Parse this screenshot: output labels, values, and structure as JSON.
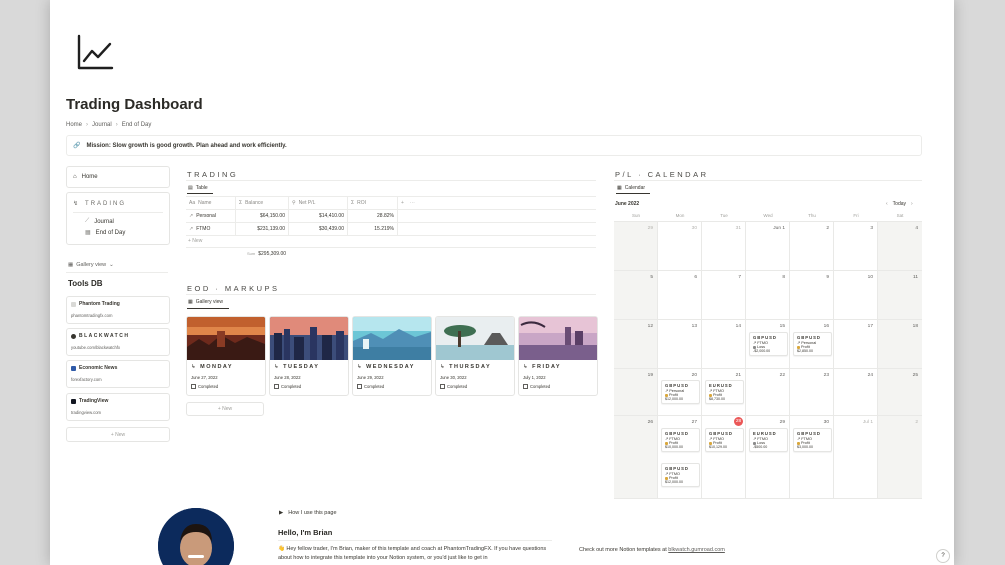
{
  "page": {
    "title": "Trading Dashboard",
    "breadcrumbs": [
      "Home",
      "Journal",
      "End of Day"
    ],
    "callout": "Mission: Slow growth is good growth. Plan ahead and work efficiently."
  },
  "nav": {
    "home": "Home",
    "trading_header": "TRADING",
    "items": [
      "Journal",
      "End of Day"
    ]
  },
  "tools": {
    "view_label": "Gallery view",
    "title": "Tools DB",
    "cards": [
      {
        "name": "Phantom Trading",
        "url": "phantomtradingfx.com",
        "color": "#d9d9d6"
      },
      {
        "name": "BLACKWATCH",
        "url": "youtube.com/blackwatchfx",
        "color": "#37352f"
      },
      {
        "name": "Economic News",
        "url": "forexfactory.com",
        "color": "#2f5aa8"
      },
      {
        "name": "TradingView",
        "url": "tradingview.com",
        "color": "#131722"
      }
    ],
    "new_label": "+ New"
  },
  "trading": {
    "title": "TRADING",
    "tab": "Table",
    "columns": [
      "Name",
      "Balance",
      "Net P/L",
      "ROI"
    ],
    "rows": [
      {
        "name": "Personal",
        "balance": "$64,150.00",
        "net": "$14,410.00",
        "roi": "28.82%"
      },
      {
        "name": "FTMO",
        "balance": "$231,139.00",
        "net": "$30,439.00",
        "roi": "15.219%"
      }
    ],
    "new_label": "+ New",
    "sum_label": "Sum",
    "sum_value": "$295,309.00"
  },
  "eod": {
    "title": "EOD · MARKUPS",
    "tab": "Gallery view",
    "cards": [
      {
        "day": "MONDAY",
        "date": "June 27, 2022",
        "status": "Completed"
      },
      {
        "day": "TUESDAY",
        "date": "June 28, 2022",
        "status": "Completed"
      },
      {
        "day": "WEDNESDAY",
        "date": "June 29, 2022",
        "status": "Completed"
      },
      {
        "day": "THURSDAY",
        "date": "June 30, 2022",
        "status": "Completed"
      },
      {
        "day": "FRIDAY",
        "date": "July 1, 2022",
        "status": "Completed"
      }
    ],
    "new_label": "+ New"
  },
  "calendar": {
    "title": "P/L · CALENDAR",
    "tab": "Calendar",
    "month": "June 2022",
    "today_label": "Today",
    "weekdays": [
      "Sun",
      "Mon",
      "Tue",
      "Wed",
      "Thu",
      "Fri",
      "Sat"
    ],
    "weeks": [
      [
        "29",
        "30",
        "31",
        "Jun 1",
        "2",
        "3",
        "4"
      ],
      [
        "5",
        "6",
        "7",
        "8",
        "9",
        "10",
        "11"
      ],
      [
        "12",
        "13",
        "14",
        "15",
        "16",
        "17",
        "18"
      ],
      [
        "19",
        "20",
        "21",
        "22",
        "23",
        "24",
        "25"
      ],
      [
        "26",
        "27",
        "28",
        "29",
        "30",
        "Jul 1",
        "2"
      ]
    ],
    "events": {
      "w2d3": {
        "pair": "GBPUSD",
        "acct": "FTMO",
        "result": "Loss",
        "amount": "-$2,000.00"
      },
      "w2d4": {
        "pair": "GBPUSD",
        "acct": "Personal",
        "result": "Profit",
        "amount": "$2,850.00"
      },
      "w3d1": {
        "pair": "GBPUSD",
        "acct": "Personal",
        "result": "Profit",
        "amount": "$12,000.00"
      },
      "w3d2": {
        "pair": "EURUSD",
        "acct": "FTMO",
        "result": "Profit",
        "amount": "$8,730.00"
      },
      "w4d1a": {
        "pair": "GBPUSD",
        "acct": "FTMO",
        "result": "Profit",
        "amount": "$10,000.00"
      },
      "w4d1b": {
        "pair": "GBPUSD",
        "acct": "FTMO",
        "result": "Profit",
        "amount": "$12,000.00"
      },
      "w4d2": {
        "pair": "GBPUSD",
        "acct": "FTMO",
        "result": "Profit",
        "amount": "$10,129.00"
      },
      "w4d3": {
        "pair": "EURUSD",
        "acct": "FTMO",
        "result": "Loss",
        "amount": "-$500.00"
      },
      "w4d4": {
        "pair": "GBPUSD",
        "acct": "FTMO",
        "result": "Profit",
        "amount": "$3,000.00"
      }
    },
    "colors": {
      "profit": "#d9a73b",
      "loss": "#8b8b8b",
      "today": "#eb5757"
    }
  },
  "bottom": {
    "toggle": "How I use this page",
    "hello": "Hello, I'm Brian",
    "bio": "👋 Hey fellow trader, I'm Brian, maker of this template and coach at PhantomTradingFX. If you have questions about how to integrate this template into your Notion system, or you'd just like to get in",
    "more_text": "Check out more Notion templates at",
    "more_link": "blkwatch.gumroad.com",
    "help": "?"
  }
}
